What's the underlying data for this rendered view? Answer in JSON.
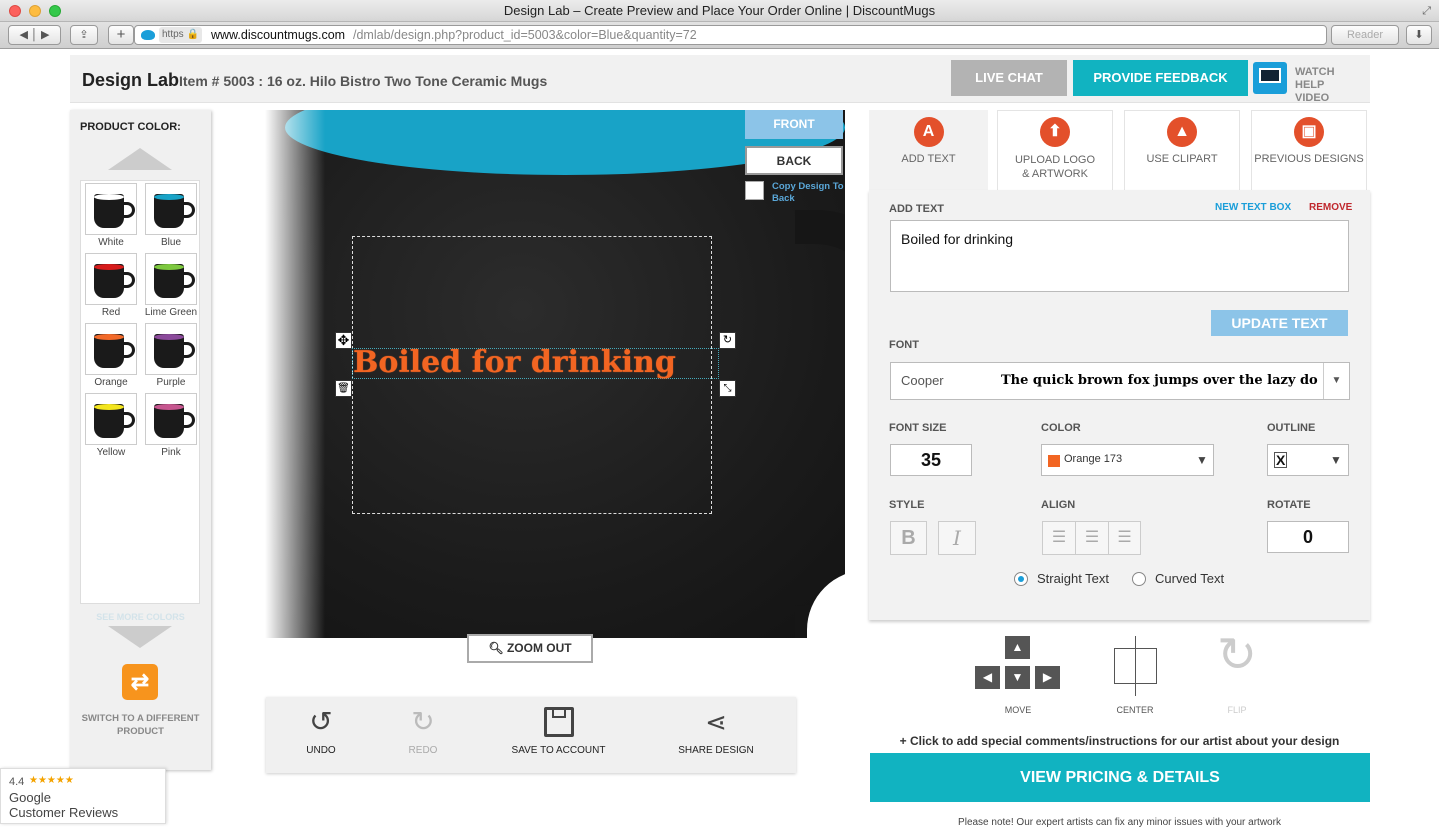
{
  "browser": {
    "title": "Design Lab – Create Preview and Place Your Order Online | DiscountMugs",
    "scheme": "https",
    "url_domain": "www.discountmugs.com",
    "url_path": "/dmlab/design.php?product_id=5003&color=Blue&quantity=72",
    "reader": "Reader"
  },
  "header": {
    "app_name": "Design Lab",
    "item": "Item # 5003 : 16 oz. Hilo Bistro Two Tone Ceramic Mugs",
    "live_chat": "LIVE CHAT",
    "feedback": "PROVIDE FEEDBACK",
    "watch_video": "WATCH HELP VIDEO"
  },
  "colors_panel": {
    "title": "PRODUCT COLOR:",
    "see_more": "SEE MORE COLORS",
    "switch_product": "SWITCH TO A DIFFERENT PRODUCT",
    "swatches": [
      {
        "name": "White",
        "color": "#ffffff"
      },
      {
        "name": "Blue",
        "color": "#18a3c7"
      },
      {
        "name": "Red",
        "color": "#d61b1b"
      },
      {
        "name": "Lime Green",
        "color": "#7dc83f"
      },
      {
        "name": "Orange",
        "color": "#f26a2a"
      },
      {
        "name": "Purple",
        "color": "#8b4a9b"
      },
      {
        "name": "Yellow",
        "color": "#f3e51e"
      },
      {
        "name": "Pink",
        "color": "#c6568f"
      }
    ]
  },
  "canvas": {
    "front": "FRONT",
    "back": "BACK",
    "copy_design": "Copy Design To Back",
    "design_text": "Boiled for drinking",
    "zoom_out": "ZOOM OUT"
  },
  "actions": {
    "undo": "UNDO",
    "redo": "REDO",
    "save": "SAVE TO ACCOUNT",
    "share": "SHARE DESIGN"
  },
  "tabs": {
    "add_text": "ADD TEXT",
    "upload": "UPLOAD LOGO & ARTWORK",
    "clipart": "USE CLIPART",
    "previous": "PREVIOUS DESIGNS"
  },
  "editor": {
    "add_text_label": "ADD TEXT",
    "new_text_box": "NEW TEXT BOX",
    "remove": "REMOVE",
    "text_value": "Boiled for drinking",
    "update_text": "UPDATE TEXT",
    "font_label": "FONT",
    "font_name": "Cooper",
    "font_preview": "The quick brown fox jumps over the lazy do",
    "font_size_label": "FONT SIZE",
    "font_size": "35",
    "color_label": "COLOR",
    "color_value": "Orange 173",
    "color_hex": "#f26522",
    "outline_label": "OUTLINE",
    "outline_value": "X",
    "style_label": "STYLE",
    "align_label": "ALIGN",
    "rotate_label": "ROTATE",
    "rotate_value": "0",
    "straight": "Straight Text",
    "curved": "Curved Text"
  },
  "controls": {
    "move": "MOVE",
    "center": "CENTER",
    "flip": "FLIP"
  },
  "footer": {
    "comments": "+ Click to add special comments/instructions for our artist about your design",
    "pricing": "VIEW PRICING & DETAILS",
    "note": "Please note! Our expert artists can fix any minor issues with your artwork"
  },
  "reviews": {
    "rating": "4.4",
    "source": "Google",
    "label": "Customer Reviews"
  }
}
